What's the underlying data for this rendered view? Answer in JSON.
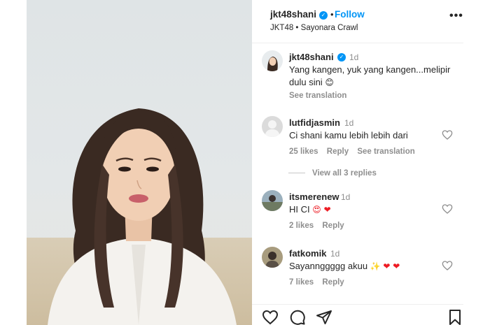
{
  "post": {
    "username": "jkt48shani",
    "follow_label": "Follow",
    "separator": "•",
    "subtitle": "JKT48 • Sayonara Crawl",
    "more_label": "•••"
  },
  "caption": {
    "username": "jkt48shani",
    "time": "1d",
    "text_line1": "Yang kangen, yuk yang kangen...melipir",
    "text_line2": "dulu sini",
    "emoji": "😊",
    "see_translation": "See translation"
  },
  "comments": [
    {
      "username": "lutfidjasmin",
      "time": "1d",
      "text": "Ci shani kamu lebih lebih dari",
      "likes": "25 likes",
      "reply": "Reply",
      "see_translation": "See translation",
      "view_replies": "View all 3 replies"
    },
    {
      "username": "itsmerenew",
      "time": "1d",
      "text": "HI CI",
      "emojis": "😍 ❤",
      "likes": "2 likes",
      "reply": "Reply"
    },
    {
      "username": "fatkomik",
      "time": "1d",
      "text": "Sayannggggg akuu",
      "emojis": "✨ ❤ ❤",
      "likes": "7 likes",
      "reply": "Reply"
    }
  ],
  "icons": {
    "like": "heart-icon",
    "comment": "comment-bubble-icon",
    "share": "paper-plane-icon",
    "save": "bookmark-icon",
    "verified": "verified-badge-icon"
  },
  "colors": {
    "link": "#0095f6",
    "muted": "#8e8e8e",
    "heart_red": "#ed1c24"
  }
}
